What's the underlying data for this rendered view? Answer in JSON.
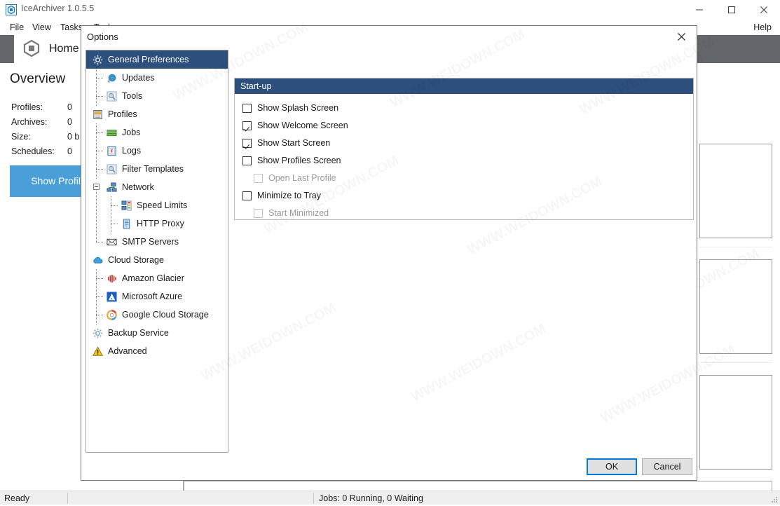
{
  "window": {
    "title": "IceArchiver 1.0.5.5",
    "app_icon": "app-hexagon-icon",
    "controls": {
      "minimize": "minimize-icon",
      "maximize": "maximize-icon",
      "close": "close-icon"
    }
  },
  "menubar": {
    "items": [
      {
        "label": "File"
      },
      {
        "label": "View"
      },
      {
        "label": "Tasks"
      },
      {
        "label": "Tools"
      }
    ],
    "help_label": "Help"
  },
  "tabstrip": {
    "active_tab": "Home",
    "tab_icon": "app-hexagon-icon"
  },
  "overview": {
    "title": "Overview",
    "stats": [
      {
        "label": "Profiles:",
        "value": "0"
      },
      {
        "label": "Archives:",
        "value": "0"
      },
      {
        "label": "Size:",
        "value": "0 b"
      },
      {
        "label": "Schedules:",
        "value": "0"
      }
    ],
    "show_profiles_label": "Show Profiles"
  },
  "statusbar": {
    "ready": "Ready",
    "jobs": "Jobs: 0 Running, 0 Waiting"
  },
  "dialog": {
    "title": "Options",
    "close_icon": "close-icon",
    "tree": [
      {
        "label": "General Preferences",
        "icon": "gear-icon",
        "level": 0,
        "selected": true
      },
      {
        "label": "Updates",
        "icon": "globe-icon",
        "level": 1,
        "selected": false
      },
      {
        "label": "Tools",
        "icon": "tools-icon",
        "level": 1,
        "selected": false
      },
      {
        "label": "Profiles",
        "icon": "profiles-icon",
        "level": 0,
        "selected": false
      },
      {
        "label": "Jobs",
        "icon": "jobs-icon",
        "level": 1,
        "selected": false
      },
      {
        "label": "Logs",
        "icon": "logs-icon",
        "level": 1,
        "selected": false
      },
      {
        "label": "Filter Templates",
        "icon": "filter-icon",
        "level": 1,
        "selected": false
      },
      {
        "label": "Network",
        "icon": "network-icon",
        "level": 0,
        "selected": false,
        "expander": "collapse"
      },
      {
        "label": "Speed Limits",
        "icon": "speed-limits-icon",
        "level": 2,
        "selected": false
      },
      {
        "label": "HTTP Proxy",
        "icon": "http-proxy-icon",
        "level": 2,
        "selected": false
      },
      {
        "label": "SMTP Servers",
        "icon": "envelope-icon",
        "level": 1,
        "selected": false
      },
      {
        "label": "Cloud Storage",
        "icon": "cloud-icon",
        "level": 0,
        "selected": false
      },
      {
        "label": "Amazon Glacier",
        "icon": "amazon-glacier-icon",
        "level": 1,
        "selected": false
      },
      {
        "label": "Microsoft Azure",
        "icon": "microsoft-azure-icon",
        "level": 1,
        "selected": false
      },
      {
        "label": "Google Cloud Storage",
        "icon": "google-cloud-icon",
        "level": 1,
        "selected": false
      },
      {
        "label": "Backup Service",
        "icon": "backup-service-icon",
        "level": 0,
        "selected": false
      },
      {
        "label": "Advanced",
        "icon": "warning-icon",
        "level": 0,
        "selected": false
      }
    ],
    "startup_group": {
      "header": "Start-up",
      "options": [
        {
          "label": "Show Splash Screen",
          "checked": false,
          "disabled": false,
          "indent": false
        },
        {
          "label": "Show Welcome Screen",
          "checked": true,
          "disabled": false,
          "indent": false
        },
        {
          "label": "Show Start Screen",
          "checked": true,
          "disabled": false,
          "indent": false
        },
        {
          "label": "Show Profiles Screen",
          "checked": false,
          "disabled": false,
          "indent": false
        },
        {
          "label": "Open Last Profile",
          "checked": false,
          "disabled": true,
          "indent": true
        },
        {
          "label": "Minimize to Tray",
          "checked": false,
          "disabled": false,
          "indent": false
        },
        {
          "label": "Start Minimized",
          "checked": false,
          "disabled": true,
          "indent": true
        }
      ]
    },
    "buttons": {
      "ok": "OK",
      "cancel": "Cancel"
    }
  },
  "colors": {
    "accent_header": "#2d4f7c",
    "toolbar": "#63666a",
    "show_profiles": "#4a9fd8",
    "focus_border": "#0078d7"
  },
  "watermark_text": "WWW.WEIDOWN.COM"
}
